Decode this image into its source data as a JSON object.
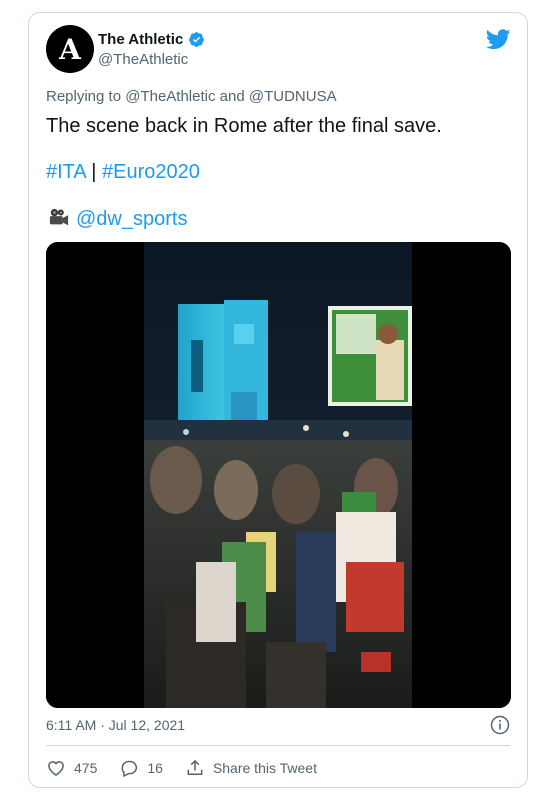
{
  "tweet": {
    "author_name": "The Athletic",
    "author_handle": "@TheAthletic",
    "avatar_letter": "A",
    "reply_prefix": "Replying to",
    "reply_to_1": "@TheAthletic",
    "reply_and": "and",
    "reply_to_2": "@TUDNUSA",
    "text": "The scene back in Rome after the final save.",
    "hashtag_1": "#ITA",
    "separator": "|",
    "hashtag_2": "#Euro2020",
    "credit_icon": "movie-camera-icon",
    "credit_mention": "@dw_sports",
    "timestamp": "6:11 AM · Jul 12, 2021"
  },
  "actions": {
    "likes": "475",
    "replies": "16",
    "share_label": "Share this Tweet"
  },
  "colors": {
    "accent": "#1d9bf0",
    "secondary_text": "#536471",
    "border": "#cfd9de"
  }
}
